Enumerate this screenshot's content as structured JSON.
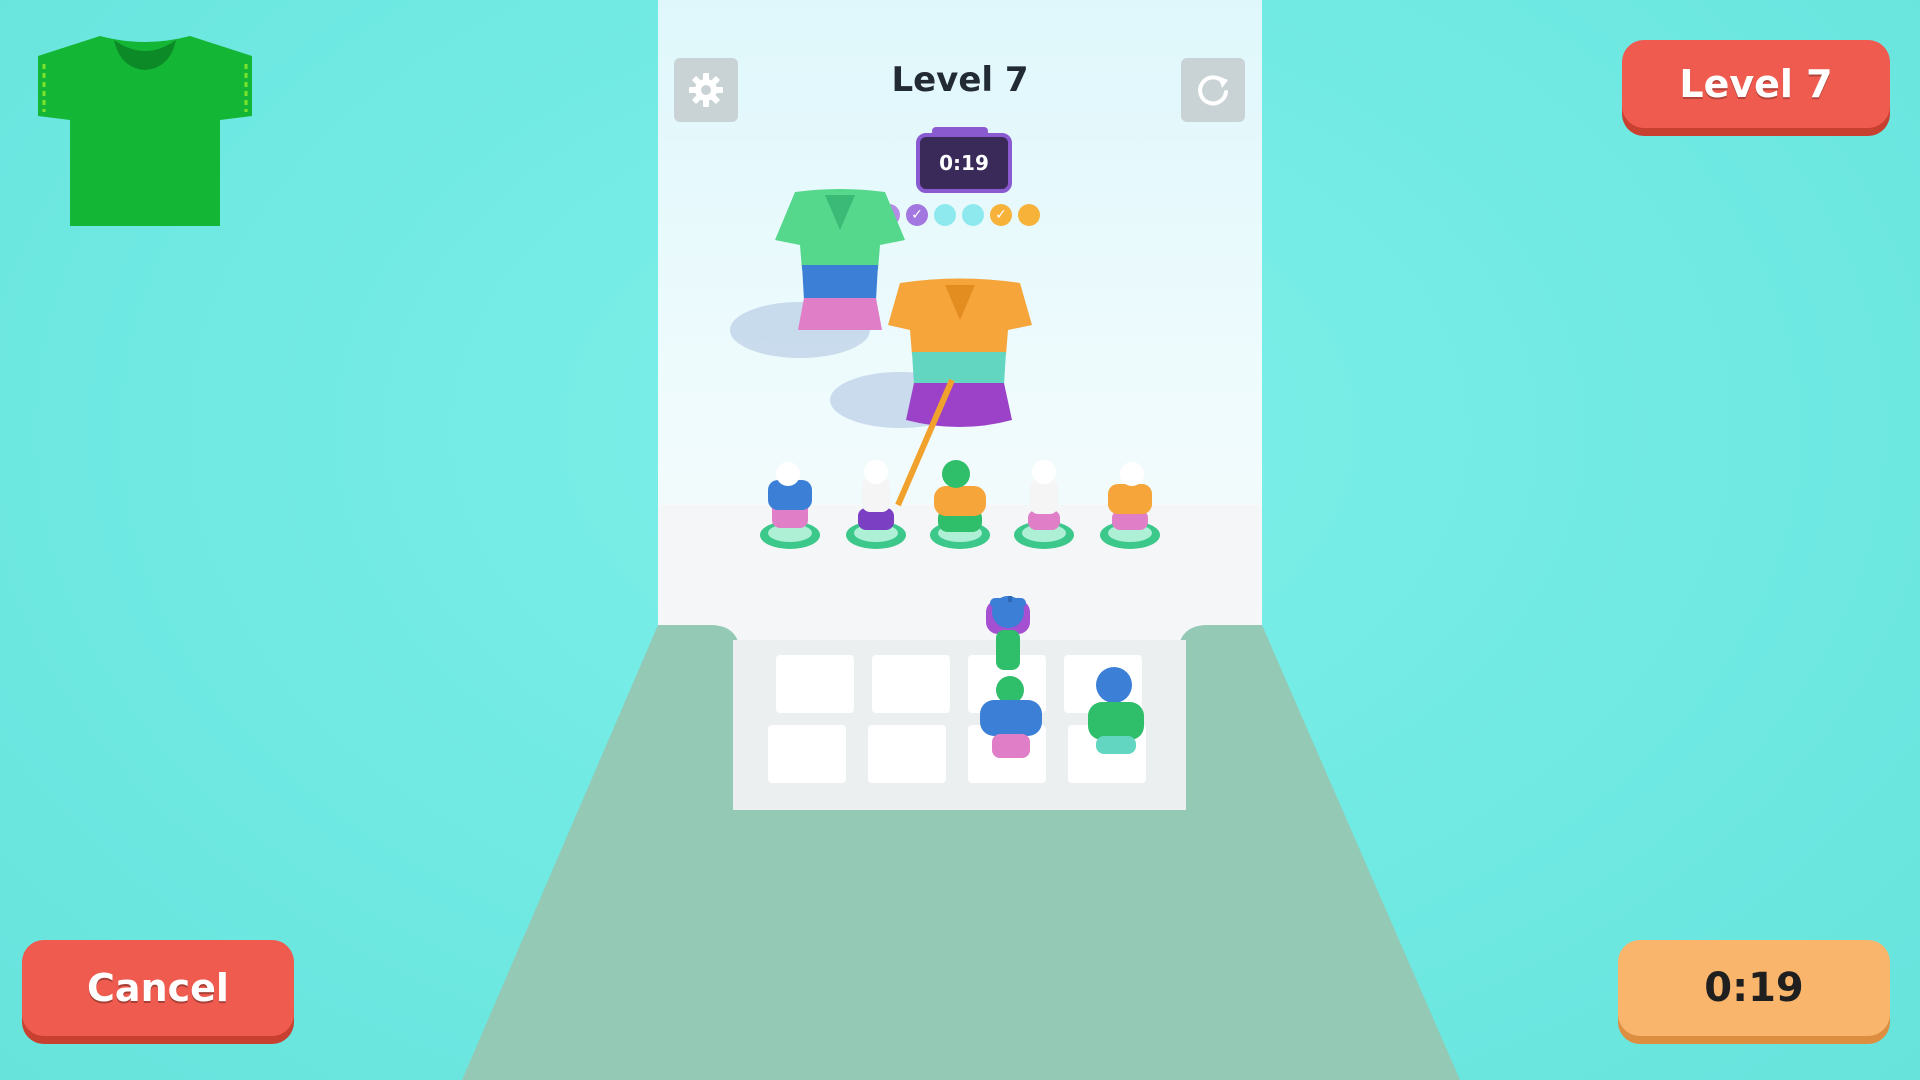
{
  "hud": {
    "level_title": "Level 7",
    "timer": "0:19",
    "progress_dots": [
      {
        "color": "#b58be6",
        "checked": true
      },
      {
        "color": "#a277e0",
        "checked": true
      },
      {
        "color": "#8ee9ef",
        "checked": false
      },
      {
        "color": "#8ee9ef",
        "checked": false
      },
      {
        "color": "#f7b23a",
        "checked": true
      },
      {
        "color": "#f7b23a",
        "checked": false
      }
    ]
  },
  "overlay": {
    "level_button": "Level 7",
    "cancel_button": "Cancel",
    "timer_button": "0:19"
  },
  "icons": {
    "settings": "gear-icon",
    "restart": "restart-icon",
    "target": "tshirt-icon"
  },
  "colors": {
    "background": "#77ede6",
    "button_red": "#ef5b4f",
    "button_orange": "#f9b56b",
    "shirt_green": "#13b635"
  }
}
